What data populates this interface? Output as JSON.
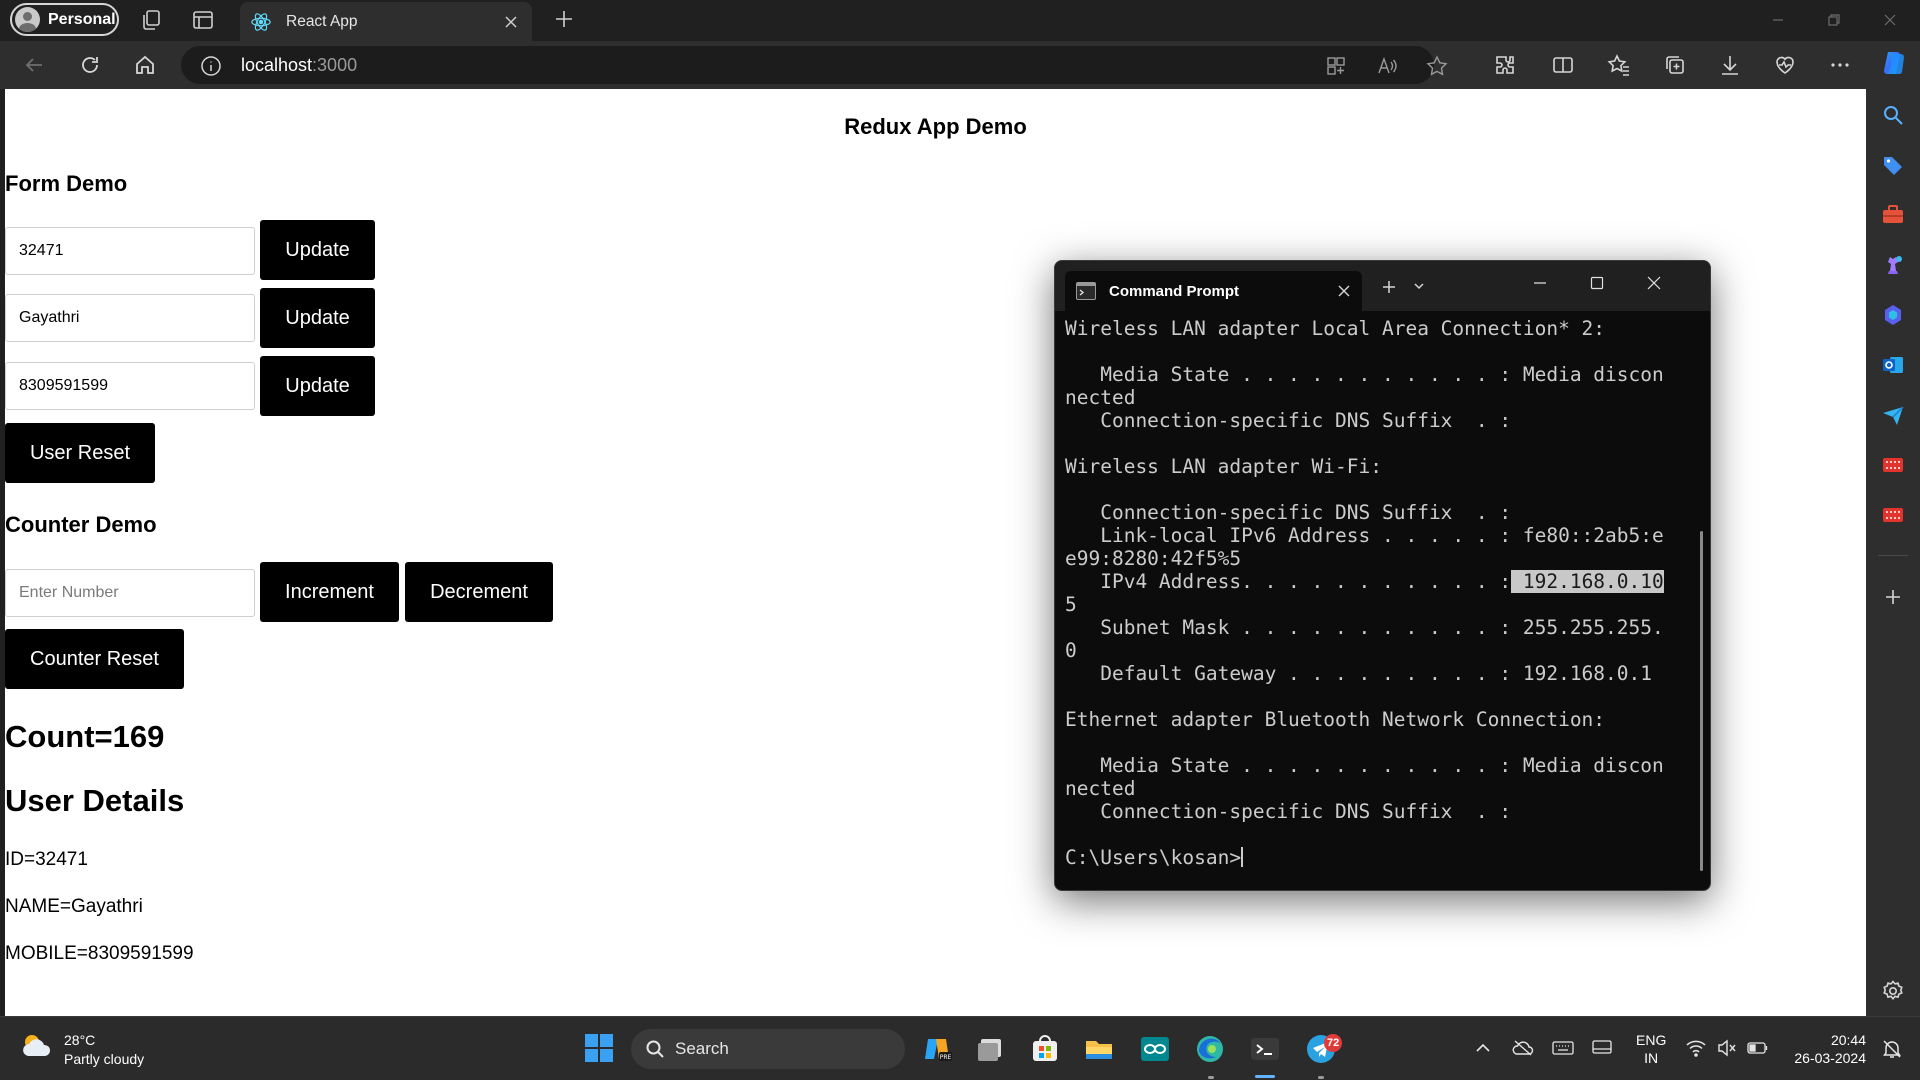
{
  "browser": {
    "profile_label": "Personal",
    "tab_title": "React App",
    "url_host": "localhost",
    "url_port": ":3000"
  },
  "page": {
    "title": "Redux App Demo",
    "form_heading": "Form Demo",
    "id_value": "32471",
    "name_value": "Gayathri",
    "mobile_value": "8309591599",
    "update_label": "Update",
    "user_reset_label": "User Reset",
    "counter_heading": "Counter Demo",
    "number_placeholder": "Enter Number",
    "increment_label": "Increment",
    "decrement_label": "Decrement",
    "counter_reset_label": "Counter Reset",
    "count_text": "Count=169",
    "user_details_heading": "User Details",
    "id_line": "ID=32471",
    "name_line": "NAME=Gayathri",
    "mobile_line": "MOBILE=8309591599"
  },
  "terminal": {
    "tab_title": "Command Prompt",
    "lines": [
      "Wireless LAN adapter Local Area Connection* 2:",
      "",
      "   Media State . . . . . . . . . . . : Media discon",
      "nected",
      "   Connection-specific DNS Suffix  . :",
      "",
      "Wireless LAN adapter Wi-Fi:",
      "",
      "   Connection-specific DNS Suffix  . :",
      "   Link-local IPv6 Address . . . . . : fe80::2ab5:e",
      "e99:8280:42f5%5",
      "   IPv4 Address. . . . . . . . . . . :",
      "5",
      "   Subnet Mask . . . . . . . . . . . : 255.255.255.",
      "0",
      "   Default Gateway . . . . . . . . . : 192.168.0.1",
      "",
      "Ethernet adapter Bluetooth Network Connection:",
      "",
      "   Media State . . . . . . . . . . . : Media discon",
      "nected",
      "   Connection-specific DNS Suffix  . :",
      ""
    ],
    "ipv4_highlight": " 192.168.0.10",
    "prompt": "C:\\Users\\kosan>"
  },
  "taskbar": {
    "temperature": "28°C",
    "condition": "Partly cloudy",
    "search_label": "Search",
    "telegram_badge": "72",
    "lang_line1": "ENG",
    "lang_line2": "IN",
    "time": "20:44",
    "date": "26-03-2024"
  },
  "colors": {
    "accent_blue": "#63b3ff",
    "button_black": "#000000",
    "terminal_bg": "#0c0c0c",
    "badge_red": "#e03b3b"
  }
}
